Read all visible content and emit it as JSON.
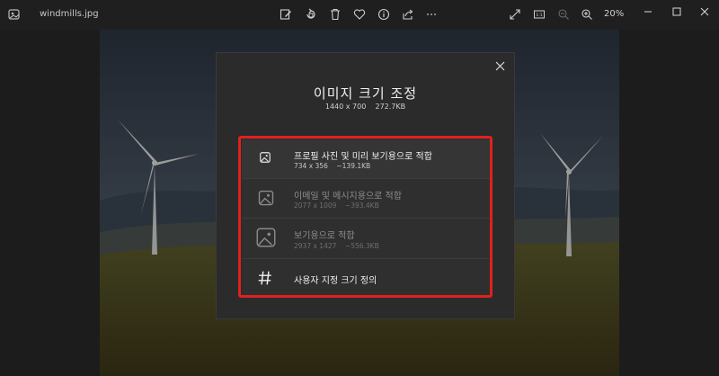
{
  "window": {
    "filename": "windmills.jpg",
    "zoom": "20%"
  },
  "toolbar": {
    "icons": [
      "app-icon",
      "edit-icon",
      "rotate-icon",
      "delete-icon",
      "heart-icon",
      "info-icon",
      "share-icon",
      "more-icon",
      "fullscreen-icon",
      "actual-size-icon",
      "zoom-out-icon",
      "zoom-in-icon"
    ]
  },
  "dialog": {
    "title": "이미지 크기 조정",
    "subtitle": "1440 x 700    272.7KB",
    "options": [
      {
        "label": "프로필 사진 및 미리 보기용으로 적합",
        "detail": "734 x 356    ~139.1KB",
        "icon": "image-small-icon",
        "enabled": true
      },
      {
        "label": "이메일 및 메시지용으로 적합",
        "detail": "2077 x 1009    ~393.4KB",
        "icon": "image-medium-icon",
        "enabled": false
      },
      {
        "label": "보기용으로 적합",
        "detail": "2937 x 1427    ~556.3KB",
        "icon": "image-large-icon",
        "enabled": false
      },
      {
        "label": "사용자 지정 크기 정의",
        "icon": "hash-icon",
        "enabled": true
      }
    ]
  },
  "colors": {
    "highlight": "#e02020",
    "dialog_bg": "#2b2b2b"
  }
}
